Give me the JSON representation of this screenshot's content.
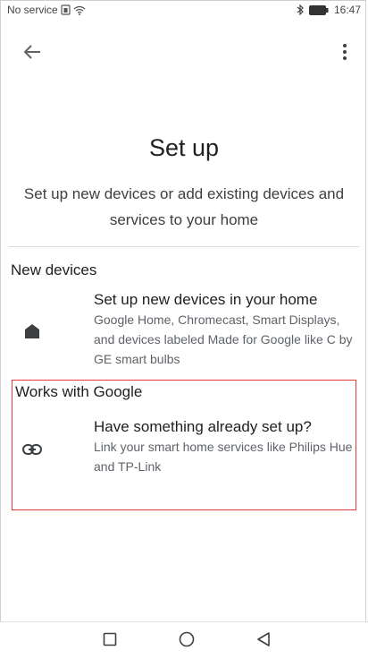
{
  "status_bar": {
    "carrier": "No service",
    "time": "16:47",
    "icons": [
      "sim-icon",
      "wifi-icon",
      "bluetooth-icon",
      "battery-icon"
    ]
  },
  "app_bar": {
    "back_icon": "arrow-back-icon",
    "more_icon": "more-vert-icon"
  },
  "header": {
    "title": "Set up",
    "subtitle": "Set up new devices or add existing devices and services to your home"
  },
  "sections": [
    {
      "header": "New devices",
      "item": {
        "icon": "home-icon",
        "title": "Set up new devices in your home",
        "description": "Google Home, Chromecast, Smart Displays, and devices labeled Made for Google like C by GE smart bulbs"
      }
    },
    {
      "header": "Works with Google",
      "item": {
        "icon": "link-icon",
        "title": "Have something already set up?",
        "description": "Link your smart home services like Philips Hue and TP-Link"
      }
    }
  ],
  "nav_bar": {
    "icons": [
      "recents-square-icon",
      "home-circle-icon",
      "back-triangle-icon"
    ]
  },
  "colors": {
    "highlight": "#e53935",
    "text_primary": "#202124",
    "text_secondary": "#5f6368",
    "icon": "#3c4043"
  }
}
